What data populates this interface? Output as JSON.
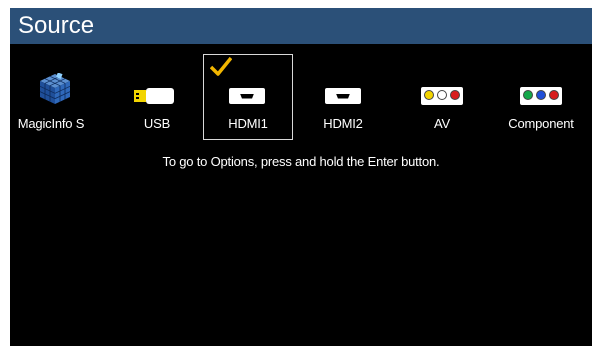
{
  "header": {
    "title": "Source"
  },
  "sources": [
    {
      "label": "MagicInfo S",
      "icon": "magicinfo-cube-icon"
    },
    {
      "label": "USB",
      "icon": "usb-drive-icon"
    },
    {
      "label": "HDMI1",
      "icon": "hdmi-port-icon",
      "selected": true
    },
    {
      "label": "HDMI2",
      "icon": "hdmi-port-icon"
    },
    {
      "label": "AV",
      "icon": "av-rca-icon"
    },
    {
      "label": "Component",
      "icon": "component-rca-icon"
    }
  ],
  "hint": "To go to Options, press and hold the Enter button.",
  "colors": {
    "title_bar": "#2b5078",
    "background": "#000000",
    "check": "#f2b600"
  }
}
